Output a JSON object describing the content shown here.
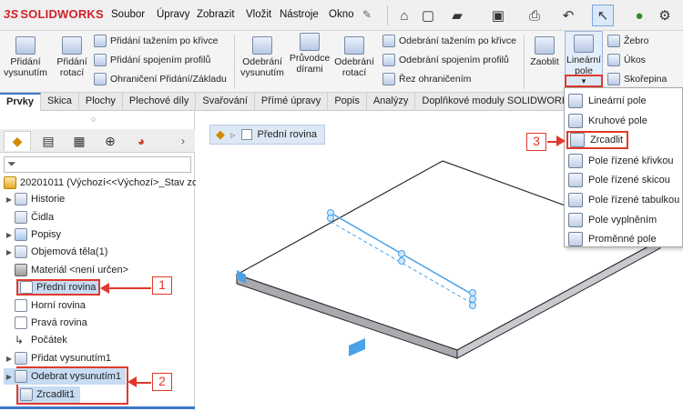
{
  "app": {
    "logo": "SOLIDWORKS",
    "logo_mark": "3S"
  },
  "menu": [
    "Soubor",
    "Úpravy",
    "Zobrazit",
    "Vložit",
    "Nástroje",
    "Okno"
  ],
  "ribbon": {
    "extrude_boss": "Přidání vysunutím",
    "revolve_boss": "Přidání rotací",
    "swept_boss": "Přidání tažením po křivce",
    "loft_boss": "Přidání spojením profilů",
    "boundary_boss": "Ohraničení Přidání/Základu",
    "extrude_cut": "Odebrání vysunutím",
    "hole_wizard": "Průvodce dírami",
    "revolve_cut": "Odebrání rotací",
    "swept_cut": "Odebrání tažením po křivce",
    "loft_cut": "Odebrání spojením profilů",
    "boundary_cut": "Řez ohraničením",
    "fillet": "Zaoblit",
    "linear_pattern": "Lineární pole",
    "rib": "Žebro",
    "draft": "Úkos",
    "shell": "Skořepina"
  },
  "tabs": [
    "Prvky",
    "Skica",
    "Plochy",
    "Plechové díly",
    "Svařování",
    "Přímé úpravy",
    "Popis",
    "Analýzy",
    "Doplňkové moduly SOLIDWORKS"
  ],
  "tree": {
    "root": "20201011  (Výchozí<<Výchozí>_Stav zob",
    "items": [
      "Historie",
      "Čidla",
      "Popisy",
      "Objemová těla(1)",
      "Materiál <není určen>",
      "Přední rovina",
      "Horní rovina",
      "Pravá rovina",
      "Počátek",
      "Přidat vysunutím1",
      "Odebrat vysunutím1",
      "Zrcadlit1"
    ]
  },
  "breadcrumb": "Přední rovina",
  "dropdown": [
    "Lineární pole",
    "Kruhové pole",
    "Zrcadlit",
    "Pole řízené křivkou",
    "Pole řízené skicou",
    "Pole řízené tabulkou",
    "Pole vyplněním",
    "Proměnné pole"
  ],
  "callouts": [
    "1",
    "2",
    "3"
  ],
  "colors": {
    "brand": "#d0202a",
    "callout": "#e0392b",
    "selection": "#c7dcf3",
    "model_edge": "#4aa3e8"
  }
}
